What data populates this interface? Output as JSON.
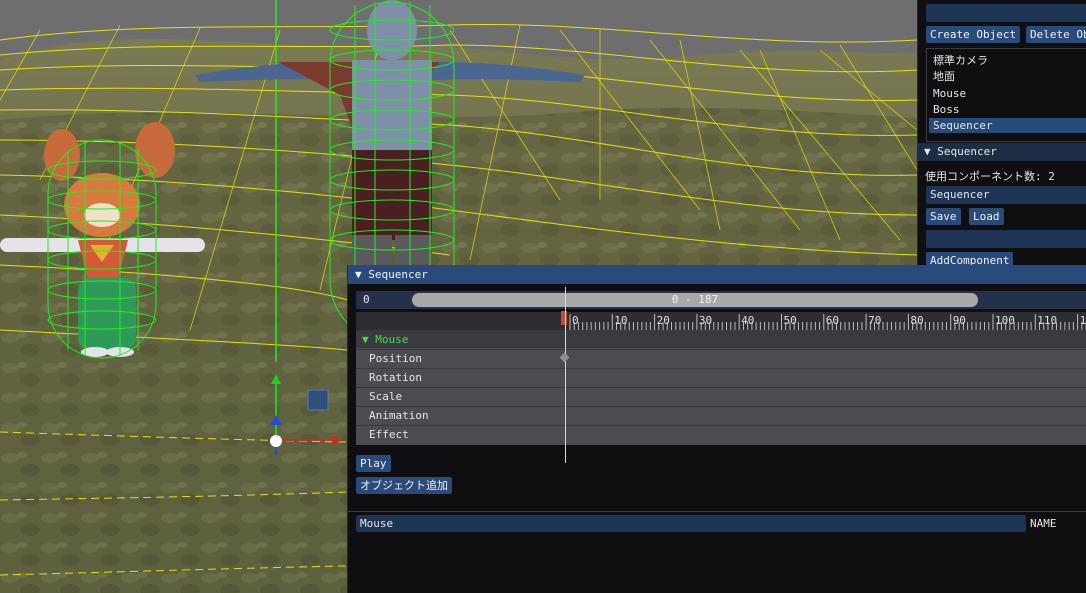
{
  "inspector": {
    "create_object_label": "Create Object",
    "delete_object_label": "Delete Ob",
    "objects": [
      "標準カメラ",
      "地面",
      "Mouse",
      "Boss",
      "Sequencer"
    ],
    "selected_object": "Sequencer",
    "component_header": "▼ Sequencer",
    "component_count_label": "使用コンポーネント数: 2",
    "component_name_value": "Sequencer",
    "save_label": "Save",
    "load_label": "Load",
    "add_component_label": "AddComponent"
  },
  "sequencer": {
    "title": "▼ Sequencer",
    "current_frame": "0",
    "range_label": "0 - 187",
    "ruler_ticks": [
      "0",
      "10",
      "20",
      "30",
      "40",
      "50",
      "60",
      "70",
      "80",
      "90",
      "100",
      "110",
      "12"
    ],
    "group_label": "▼    Mouse",
    "tracks": [
      "Position",
      "Rotation",
      "Scale",
      "Animation",
      "Effect"
    ],
    "play_label": "Play",
    "add_object_label": "オブジェクト追加",
    "name_value": "Mouse",
    "name_label": "NAME"
  },
  "colors": {
    "collider": "#22ee22",
    "terrain_wire": "#f4f000",
    "panel_bg": "#0f0f12",
    "button": "#294a7a",
    "keyframe": "#8a8f99"
  }
}
